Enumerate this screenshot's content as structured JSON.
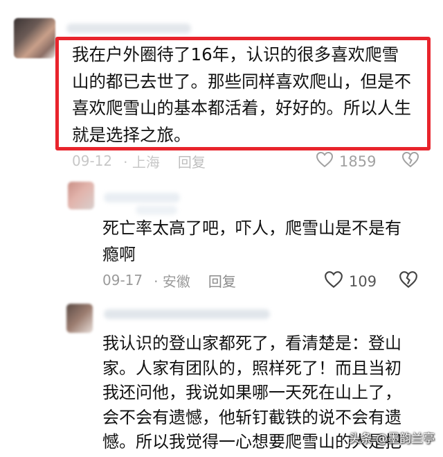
{
  "comments": [
    {
      "text": "我在户外圈待了16年，认识的很多喜欢爬雪\n山的都已去世了。那些同样喜欢爬山，但是不\n喜欢爬雪山的基本都活着，好好的。所以人生\n就是选择之旅。",
      "date": "09-12",
      "location": "· 上海",
      "reply_label": "回复",
      "likes": "1859",
      "highlighted": true
    },
    {
      "text": "死亡率太高了吧，吓人，爬雪山是不是有\n瘾啊",
      "date": "09-17",
      "location": "· 安徽",
      "reply_label": "回复",
      "likes": "109",
      "highlighted": false
    },
    {
      "text": "我认识的登山家都死了，看清楚是：登山\n家。人家有团队的，照样死了！而且当初\n我还问他，我说如果哪一天死在山上了，\n会不会有遗憾，他斩钉截铁的说不会有遗\n憾。所以我觉得一心想要爬雪山的人是把",
      "highlighted": false
    }
  ],
  "watermark": "头条 @墨韵兰亭",
  "colors": {
    "highlight_border": "#e8242c",
    "meta_text": "#9a9a9a",
    "body_text": "#111111"
  },
  "icons": {
    "like": "heart-outline-icon",
    "dislike": "broken-heart-icon"
  }
}
